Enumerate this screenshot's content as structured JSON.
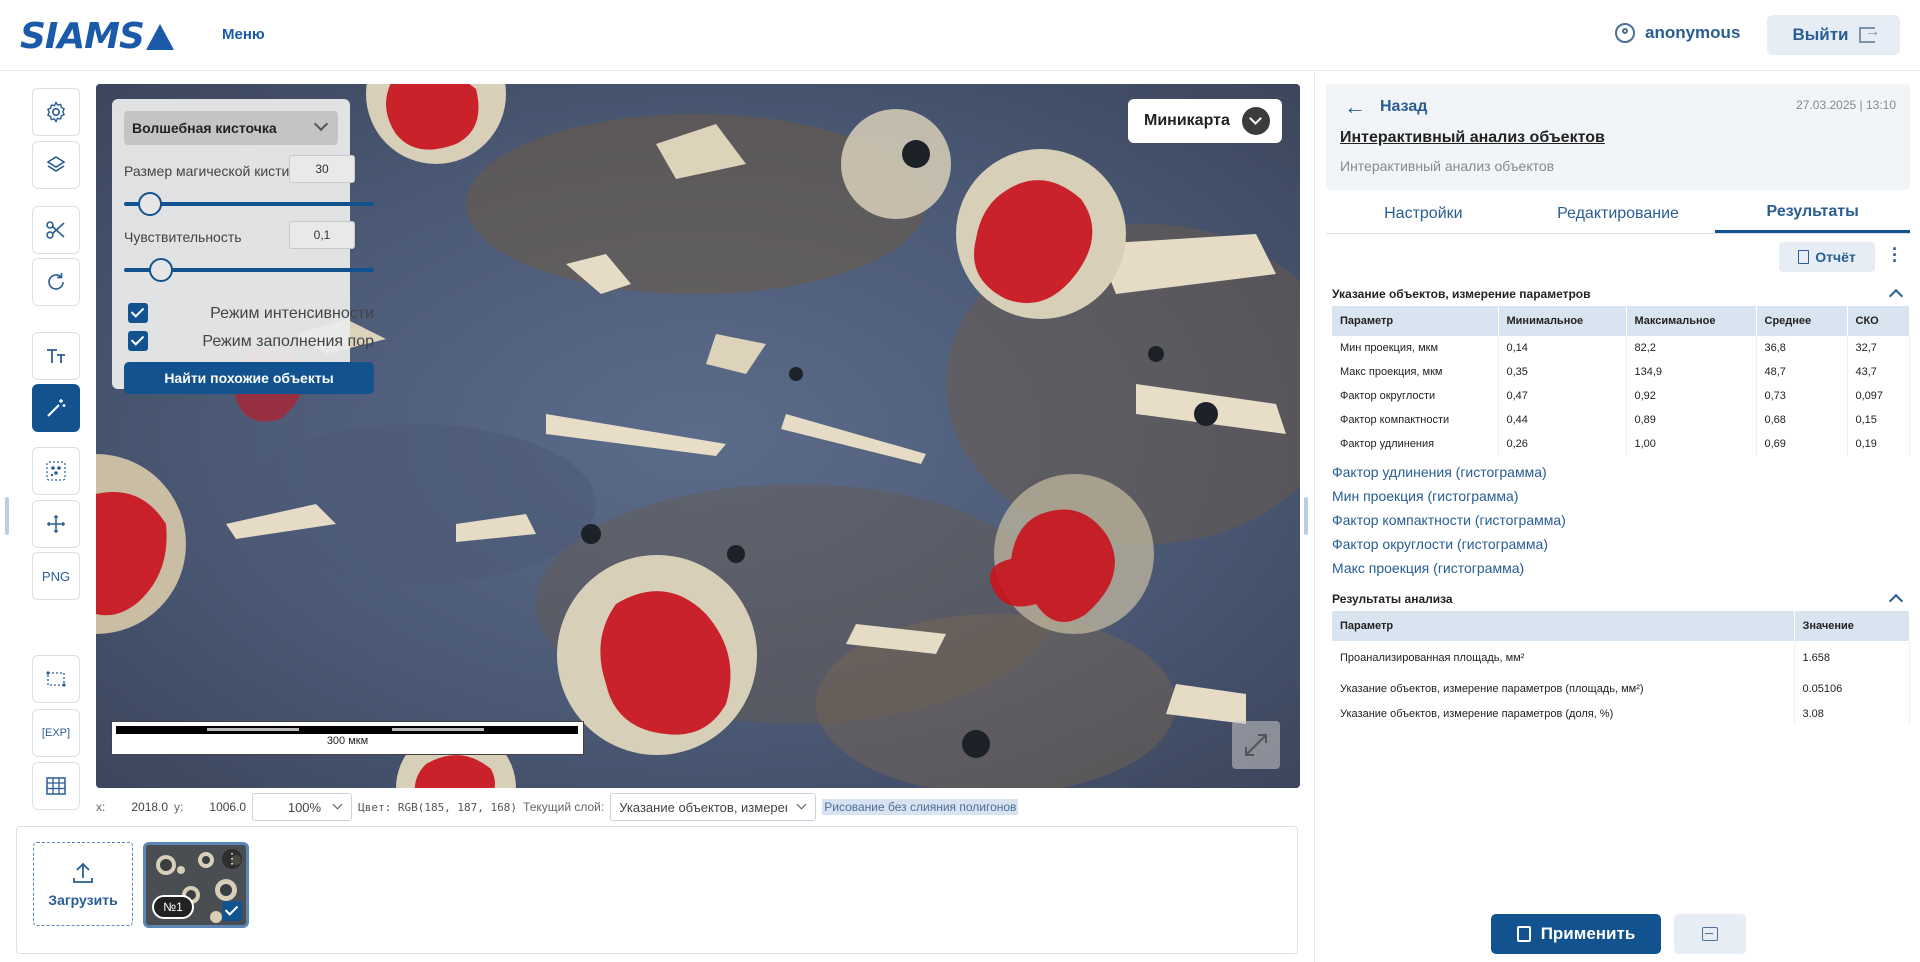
{
  "header": {
    "logo": "SIAMS",
    "menu_label": "Меню",
    "user_name": "anonymous",
    "logout_label": "Выйти"
  },
  "toolbar": {
    "tools": [
      "gear-icon",
      "layers-icon",
      "scissors-icon",
      "rotate-icon",
      "text-icon",
      "magic-wand-icon",
      "particles-icon",
      "measure-icon",
      "png-icon",
      "selection-icon",
      "export-icon",
      "table-icon"
    ],
    "png_label": "PNG",
    "exp_label": "EXP",
    "active_tool": "magic-wand-icon"
  },
  "magic_panel": {
    "tool_name": "Волшебная кисточка",
    "brush_size_label": "Размер магической кисти",
    "brush_size_value": "30",
    "brush_size_level": 0.06,
    "sensitivity_label": "Чувствительность",
    "sensitivity_value": "0,1",
    "sensitivity_level": 0.11,
    "intensity_mode_label": "Режим интенсивности",
    "intensity_mode_checked": true,
    "fill_pores_label": "Режим заполнения пор",
    "fill_pores_checked": true,
    "find_similar_label": "Найти похожие объекты"
  },
  "minimap": {
    "label": "Миникарта"
  },
  "scalebar": {
    "label": "300 мкм"
  },
  "statusbar": {
    "x_label": "x:",
    "x_value": "2018.0",
    "y_label": "y:",
    "y_value": "1006.0",
    "zoom": "100%",
    "color_text": "Цвет: RGB(185, 187, 168)",
    "layer_label": "Текущий слой:",
    "layer_value": "Указание объектов, измерение параметров",
    "draw_mode": "Рисование без слияния полигонов"
  },
  "gallery": {
    "upload_label": "Загрузить",
    "images": [
      {
        "number": "№1",
        "selected": true
      }
    ]
  },
  "right_panel": {
    "back_label": "Назад",
    "date": "27.03.2025 | 13:10",
    "title": "Интерактивный анализ объектов",
    "subtitle": "Интерактивный анализ объектов",
    "tabs": [
      "Настройки",
      "Редактирование",
      "Результаты"
    ],
    "active_tab": "Результаты",
    "report_label": "Отчёт",
    "section1_title": "Указание объектов, измерение параметров",
    "stats_columns": [
      "Параметр",
      "Минимальное",
      "Максимальное",
      "Среднее",
      "СКО"
    ],
    "stats_rows": [
      [
        "Мин проекция, мкм",
        "0,14",
        "82,2",
        "36,8",
        "32,7"
      ],
      [
        "Макс проекция, мкм",
        "0,35",
        "134,9",
        "48,7",
        "43,7"
      ],
      [
        "Фактор округлости",
        "0,47",
        "0,92",
        "0,73",
        "0,097"
      ],
      [
        "Фактор компактности",
        "0,44",
        "0,89",
        "0,68",
        "0,15"
      ],
      [
        "Фактор удлинения",
        "0,26",
        "1,00",
        "0,69",
        "0,19"
      ]
    ],
    "histogram_links": [
      "Фактор удлинения (гистограмма)",
      "Мин проекция (гистограмма)",
      "Фактор компактности (гистограмма)",
      "Фактор округлости (гистограмма)",
      "Макс проекция (гистограмма)"
    ],
    "section2_title": "Результаты анализа",
    "results_columns": [
      "Параметр",
      "Значение"
    ],
    "results_rows": [
      [
        "Проанализированная площадь, мм²",
        "1.658"
      ],
      [
        "Указание объектов, измерение параметров (площадь, мм²)",
        "0.05106"
      ],
      [
        "Указание объектов, измерение параметров (доля, %)",
        "3.08"
      ]
    ],
    "apply_label": "Применить"
  },
  "colors": {
    "accent": "#11528f",
    "brand": "#1a5aa8",
    "selection": "#c8141e"
  }
}
